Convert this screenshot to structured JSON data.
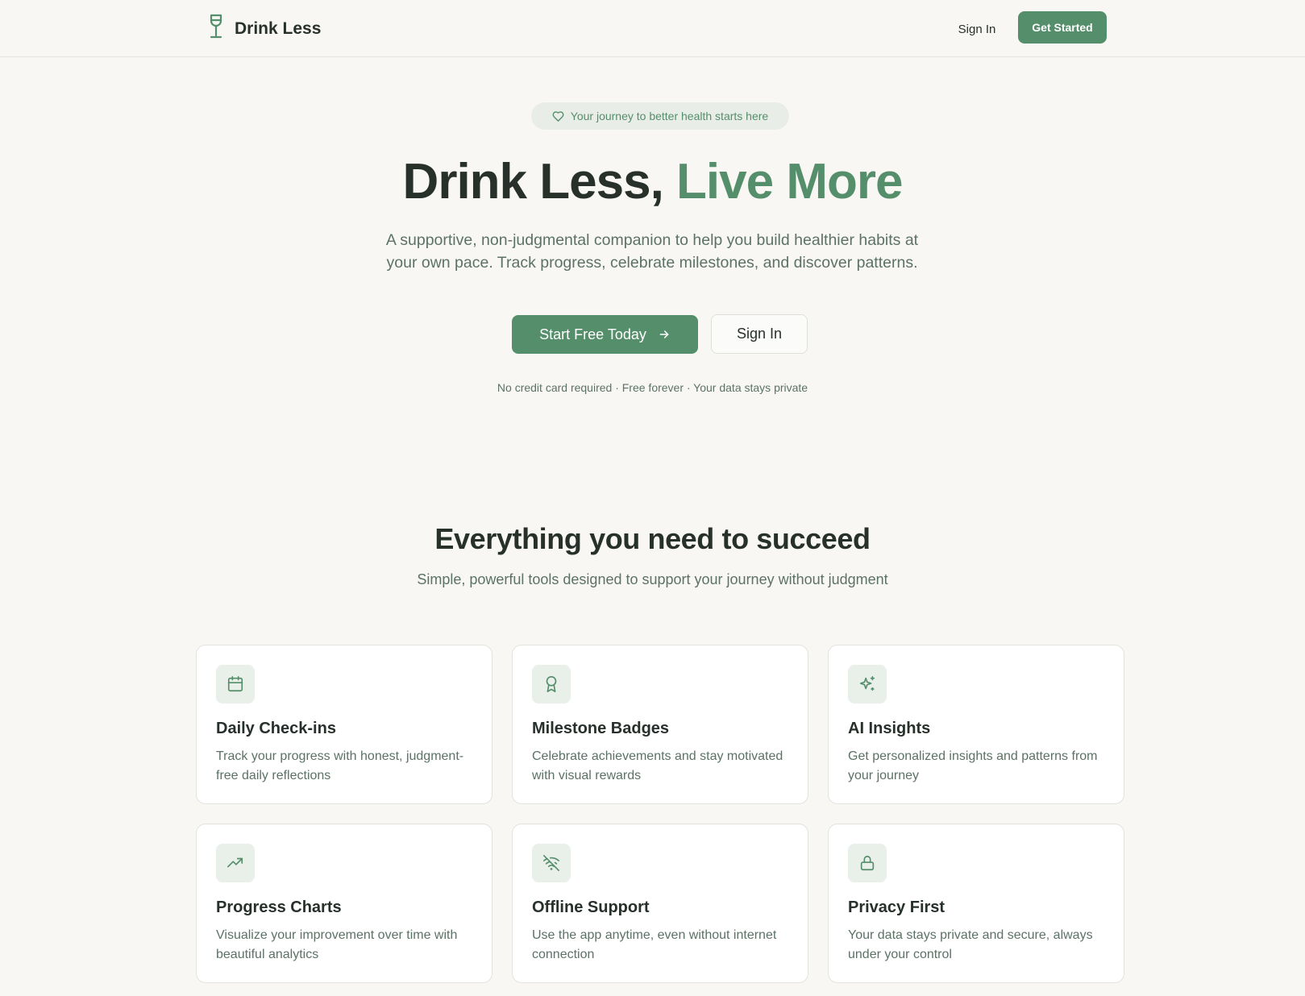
{
  "header": {
    "brand_name": "Drink Less",
    "brand_icon": "wine-glass-icon",
    "signin_label": "Sign In",
    "get_started_label": "Get Started"
  },
  "hero": {
    "badge_icon": "heart-icon",
    "badge_text": "Your journey to better health starts here",
    "title_main": "Drink Less, ",
    "title_accent": "Live More",
    "subtitle": "A supportive, non-judgmental companion to help you build healthier habits at your own pace. Track progress, celebrate milestones, and discover patterns.",
    "primary_cta": "Start Free Today",
    "primary_cta_icon": "arrow-right-icon",
    "secondary_cta": "Sign In",
    "note": "No credit card required · Free forever · Your data stays private"
  },
  "features": {
    "title": "Everything you need to succeed",
    "subtitle": "Simple, powerful tools designed to support your journey without judgment",
    "cards": [
      {
        "icon": "calendar-icon",
        "title": "Daily Check-ins",
        "desc": "Track your progress with honest, judgment-free daily reflections"
      },
      {
        "icon": "award-icon",
        "title": "Milestone Badges",
        "desc": "Celebrate achievements and stay motivated with visual rewards"
      },
      {
        "icon": "sparkles-icon",
        "title": "AI Insights",
        "desc": "Get personalized insights and patterns from your journey"
      },
      {
        "icon": "trending-up-icon",
        "title": "Progress Charts",
        "desc": "Visualize your improvement over time with beautiful analytics"
      },
      {
        "icon": "wifi-off-icon",
        "title": "Offline Support",
        "desc": "Use the app anytime, even without internet connection"
      },
      {
        "icon": "lock-icon",
        "title": "Privacy First",
        "desc": "Your data stays private and secure, always under your control"
      }
    ]
  },
  "colors": {
    "accent": "#558e6b",
    "background": "#f8f7f4",
    "text": "#27302a",
    "muted": "#5c7266",
    "icon_tile": "#e9efe9"
  }
}
